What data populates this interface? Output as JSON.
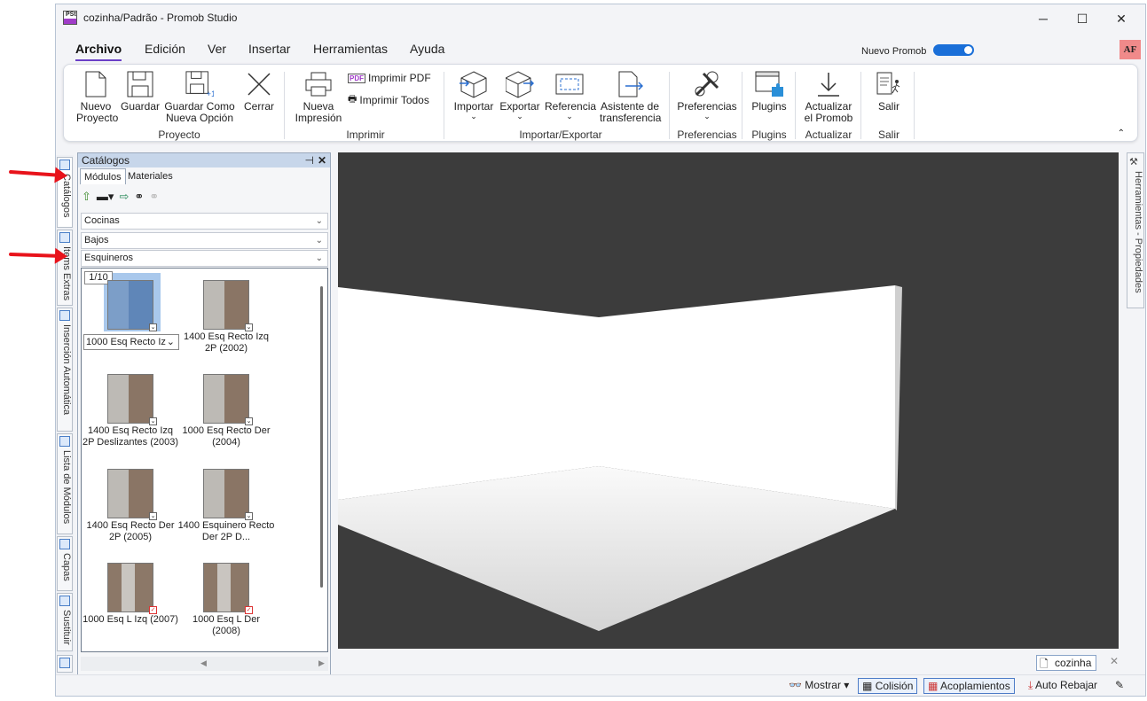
{
  "window": {
    "title": "cozinha/Padrão - Promob Studio",
    "app_icon": "PSt",
    "controls": [
      "minimize-icon",
      "maximize-icon",
      "close-icon"
    ]
  },
  "menu": {
    "items": [
      "Archivo",
      "Edición",
      "Ver",
      "Insertar",
      "Herramientas",
      "Ayuda"
    ],
    "active": "Archivo"
  },
  "header": {
    "nuevo_promob": "Nuevo Promob",
    "avatar": "AF"
  },
  "ribbon": {
    "nuevo": "Nuevo Proyecto",
    "guardar": "Guardar",
    "guardar_como": "Guardar Como Nueva Opción",
    "cerrar": "Cerrar",
    "group_proyecto": "Proyecto",
    "nueva_impresion": "Nueva Impresión",
    "imprimir_pdf": "Imprimir PDF",
    "imprimir_todos": "Imprimir Todos",
    "group_imprimir": "Imprimir",
    "importar": "Importar",
    "exportar": "Exportar",
    "referencia": "Referencia",
    "asistente": "Asistente de transferencia",
    "group_importar": "Importar/Exportar",
    "preferencias": "Preferencias",
    "group_preferencias": "Preferencias",
    "plugins": "Plugins",
    "group_plugins": "Plugins",
    "actualizar": "Actualizar el Promob",
    "group_actualizar": "Actualizar",
    "salir": "Salir",
    "group_salir": "Salir"
  },
  "left_tabs": [
    "Catálogos",
    "Items Extras",
    "Inserción Automática",
    "Lista de Módulos",
    "Capas",
    "Sustituir"
  ],
  "catalog": {
    "title": "Catálogos",
    "tabs": [
      "Módulos",
      "Materiales"
    ],
    "combo1": "Cocinas",
    "combo2": "Bajos",
    "combo3": "Esquineros",
    "page": "1/10",
    "items": [
      "1000 Esq Recto Iz",
      "1400 Esq Recto Izq 2P (2002)",
      "1400 Esq Recto Izq 2P Deslizantes (2003)",
      "1000 Esq Recto Der (2004)",
      "1400 Esq Recto Der 2P (2005)",
      "1400 Esquinero Recto Der 2P D...",
      "1000 Esq L Izq (2007)",
      "1000 Esq L Der (2008)"
    ]
  },
  "right_tab": "Herramientas - Propiedades",
  "doc_tab": "cozinha",
  "status": {
    "mostrar": "Mostrar",
    "colision": "Colisión",
    "acoplamientos": "Acoplamientos",
    "auto_rebajar": "Auto Rebajar"
  }
}
